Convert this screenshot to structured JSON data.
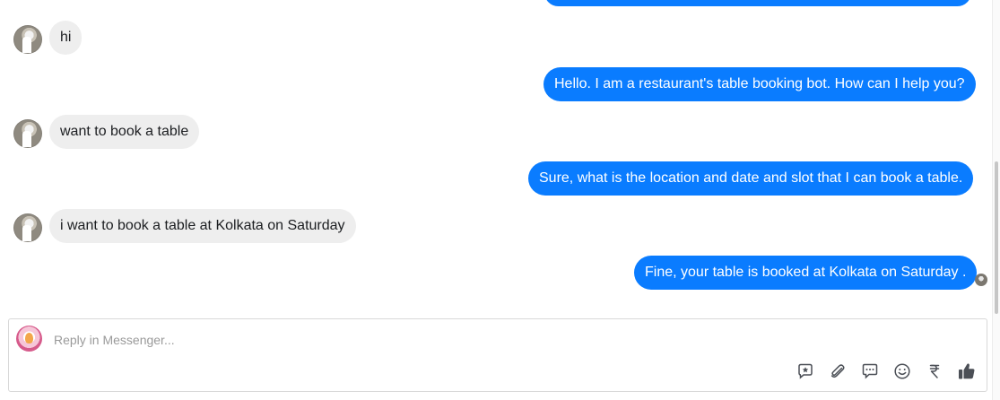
{
  "messages": [
    {
      "side": "in",
      "text": "hi"
    },
    {
      "side": "out",
      "text": "Hello. I am a restaurant's table booking bot. How can I help you?"
    },
    {
      "side": "in",
      "text": "want to book a table"
    },
    {
      "side": "out",
      "text": "Sure, what is the location and date and slot that I can book a table."
    },
    {
      "side": "in",
      "text": "i want to book a table at Kolkata on Saturday"
    },
    {
      "side": "out",
      "text": "Fine, your table is booked at Kolkata on Saturday ."
    }
  ],
  "composer": {
    "placeholder": "Reply in Messenger...",
    "value": ""
  },
  "toolbar": {
    "icons": [
      "sticker-icon",
      "attachment-icon",
      "chat-bubbles-icon",
      "emoji-icon",
      "rupee-icon",
      "thumbs-up-icon"
    ]
  },
  "colors": {
    "outgoing_bubble": "#0a7cff",
    "incoming_bubble": "#eeeeee",
    "icon": "#4b4f56"
  }
}
